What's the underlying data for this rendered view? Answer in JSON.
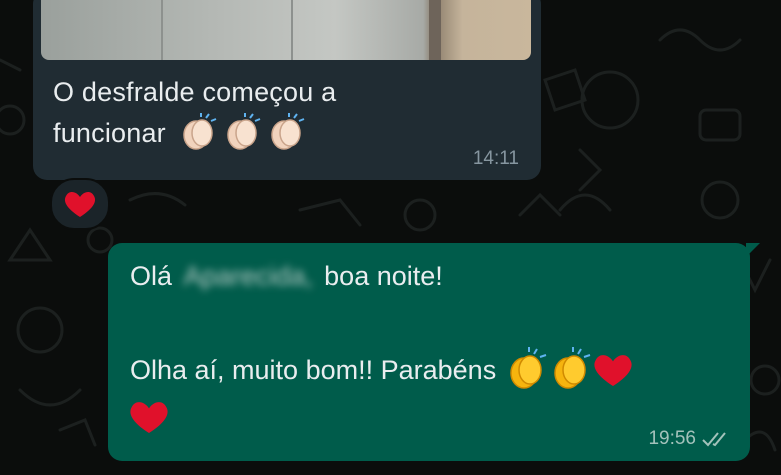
{
  "incoming": {
    "text_line1": "O desfralde começou a",
    "text_line2": "funcionar",
    "time": "14:11",
    "emoji": [
      "clapping-hands",
      "clapping-hands",
      "clapping-hands"
    ],
    "reaction": "red-heart"
  },
  "outgoing": {
    "greeting": "Olá",
    "name_blurred": "Aparecida,",
    "greeting_rest": "boa noite!",
    "line2": "Olha aí, muito bom!! Parabéns",
    "emoji": [
      "clapping-hands",
      "clapping-hands",
      "red-heart",
      "red-heart"
    ],
    "time": "19:56",
    "status": "delivered-double-check"
  },
  "colors": {
    "incoming_bubble": "#202c33",
    "outgoing_bubble": "#005c4b",
    "background": "#0b0d0c",
    "text": "#e9edef",
    "timestamp": "#8696a0"
  }
}
